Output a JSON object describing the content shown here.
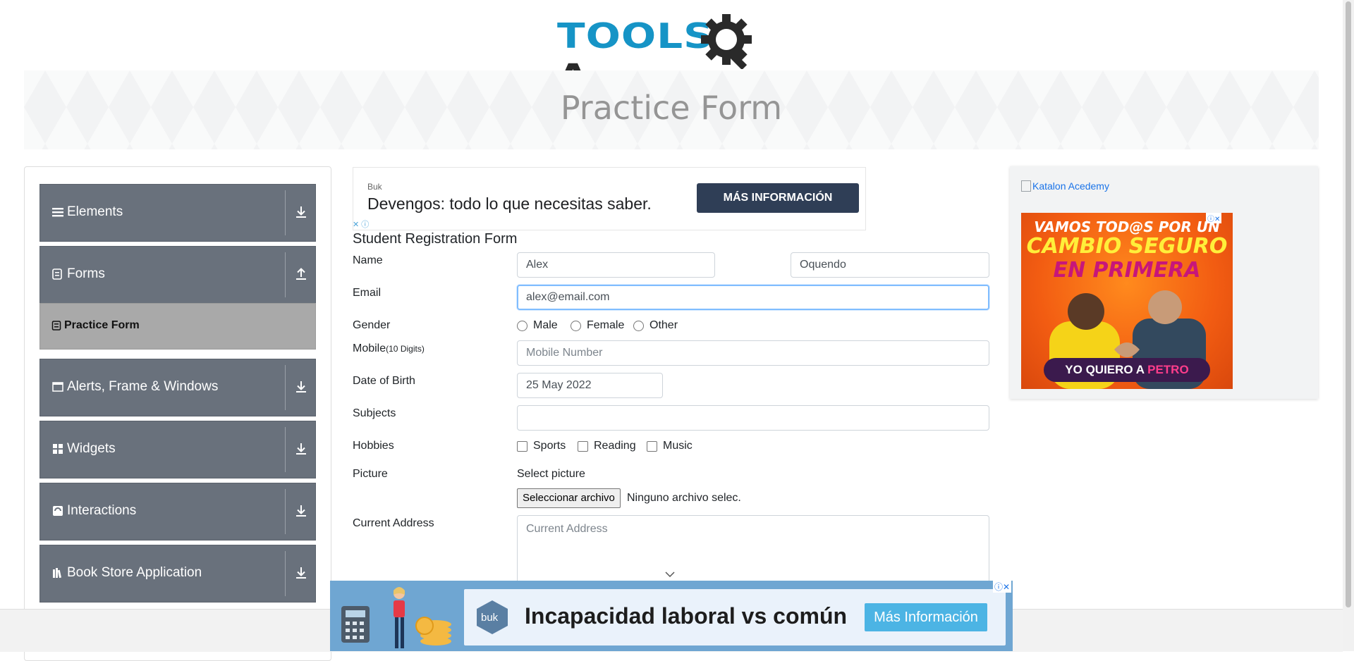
{
  "header": {
    "logo_text_blue": "TOOLS",
    "logo_text_dark": "A",
    "banner_title": "Practice Form"
  },
  "sidebar": {
    "groups": [
      {
        "label": "Elements",
        "icon": "hamburger-icon",
        "arrow": "download-arrow-icon"
      },
      {
        "label": "Forms",
        "icon": "document-icon",
        "arrow": "upload-arrow-icon"
      },
      {
        "label": "Alerts, Frame & Windows",
        "icon": "window-icon",
        "arrow": "download-arrow-icon"
      },
      {
        "label": "Widgets",
        "icon": "grid-icon",
        "arrow": "download-arrow-icon"
      },
      {
        "label": "Interactions",
        "icon": "interaction-icon",
        "arrow": "download-arrow-icon"
      },
      {
        "label": "Book Store Application",
        "icon": "books-icon",
        "arrow": "download-arrow-icon"
      }
    ],
    "active_subitem": "Practice Form"
  },
  "ad_top": {
    "brand": "Buk",
    "headline": "Devengos: todo lo que necesitas saber.",
    "cta": "MÁS INFORMACIÓN"
  },
  "form": {
    "title": "Student Registration Form",
    "labels": {
      "name": "Name",
      "email": "Email",
      "gender": "Gender",
      "mobile": "Mobile",
      "mobile_hint": "(10 Digits)",
      "dob": "Date of Birth",
      "subjects": "Subjects",
      "hobbies": "Hobbies",
      "picture": "Picture",
      "address": "Current Address"
    },
    "first_name": "Alex",
    "last_name": "Oquendo",
    "email": "alex@email.com",
    "gender_options": [
      "Male",
      "Female",
      "Other"
    ],
    "mobile_placeholder": "Mobile Number",
    "dob_value": "25 May 2022",
    "subjects_value": "",
    "hobby_options": [
      "Sports",
      "Reading",
      "Music"
    ],
    "picture_prompt": "Select picture",
    "upload_button": "Seleccionar archivo",
    "upload_status": "Ninguno archivo selec.",
    "address_placeholder": "Current Address"
  },
  "ad_right": {
    "alt_text": "Katalon Acedemy",
    "line1": "VAMOS TOD@S POR UN",
    "line2": "CAMBIO SEGURO",
    "line3": "EN PRIMERA",
    "pill_text": "YO QUIERO A",
    "pill_highlight": "PETRO"
  },
  "ad_bottom": {
    "logo": "buk",
    "headline": "Incapacidad laboral vs común",
    "cta": "Más Información"
  },
  "colors": {
    "sidebar_group_bg": "#69717c",
    "sidebar_active_bg": "#a9a9a9",
    "logo_blue": "#1694c6",
    "focus_border": "#80bdff",
    "ad_cta_bg": "#2f3e56"
  }
}
